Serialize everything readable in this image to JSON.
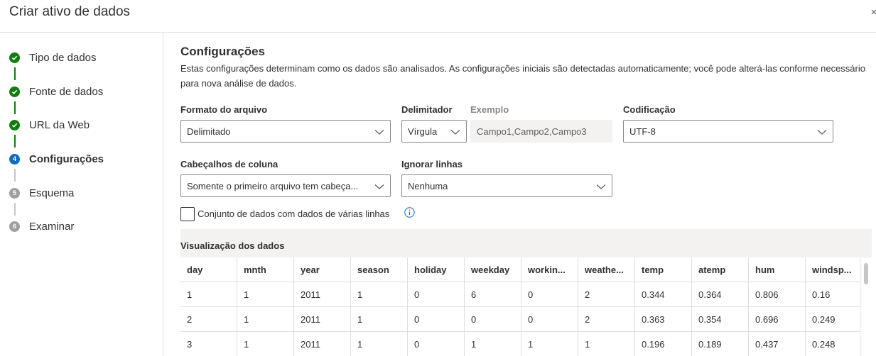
{
  "window": {
    "title": "Criar ativo de dados",
    "close_icon": "close-icon"
  },
  "steps": [
    {
      "label": "Tipo de dados",
      "state": "done",
      "number": ""
    },
    {
      "label": "Fonte de dados",
      "state": "done",
      "number": ""
    },
    {
      "label": "URL da Web",
      "state": "done",
      "number": ""
    },
    {
      "label": "Configurações",
      "state": "current",
      "number": "4"
    },
    {
      "label": "Esquema",
      "state": "pending",
      "number": "5"
    },
    {
      "label": "Examinar",
      "state": "pending",
      "number": "6"
    }
  ],
  "settings": {
    "title": "Configurações",
    "description": "Estas configurações determinam como os dados são analisados. As configurações iniciais são detectadas automaticamente; você pode alterá-las conforme necessário para nova análise de dados.",
    "file_format": {
      "label": "Formato do arquivo",
      "value": "Delimitado"
    },
    "delimiter": {
      "label": "Delimitador",
      "value": "Vírgula"
    },
    "example": {
      "label": "Exemplo",
      "value": "Campo1,Campo2,Campo3"
    },
    "encoding": {
      "label": "Codificação",
      "value": "UTF-8"
    },
    "column_headers": {
      "label": "Cabeçalhos de coluna",
      "value": "Somente o primeiro arquivo tem cabeça..."
    },
    "skip_rows": {
      "label": "Ignorar linhas",
      "value": "Nenhuma"
    },
    "multiline": {
      "label": "Conjunto de dados com dados de várias linhas",
      "checked": false
    }
  },
  "preview": {
    "title": "Visualização dos dados",
    "columns": [
      "day",
      "mnth",
      "year",
      "season",
      "holiday",
      "weekday",
      "workin...",
      "weathe...",
      "temp",
      "atemp",
      "hum",
      "windsp..."
    ],
    "rows": [
      [
        "1",
        "1",
        "2011",
        "1",
        "0",
        "6",
        "0",
        "2",
        "0.344",
        "0.364",
        "0.806",
        "0.16"
      ],
      [
        "2",
        "1",
        "2011",
        "1",
        "0",
        "0",
        "0",
        "2",
        "0.363",
        "0.354",
        "0.696",
        "0.249"
      ],
      [
        "3",
        "1",
        "2011",
        "1",
        "0",
        "1",
        "1",
        "1",
        "0.196",
        "0.189",
        "0.437",
        "0.248"
      ]
    ]
  },
  "colors": {
    "done": "#107c10",
    "current": "#0f6cbd",
    "pending": "#a19f9d",
    "info": "#0f6cbd"
  }
}
